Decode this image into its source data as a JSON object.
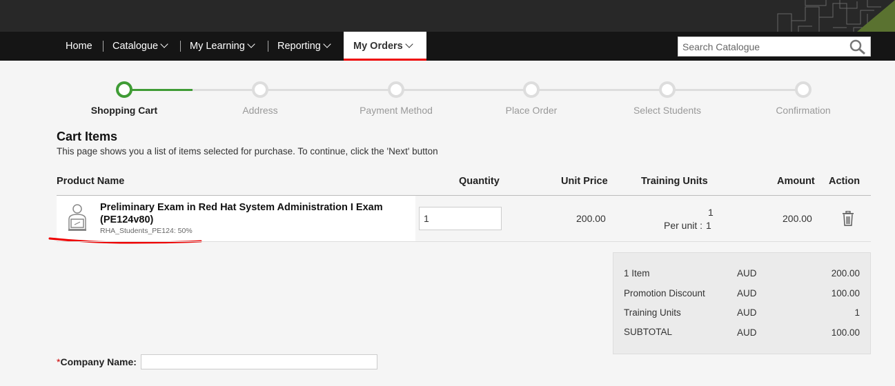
{
  "nav": {
    "items": [
      {
        "label": "Home"
      },
      {
        "label": "Catalogue"
      },
      {
        "label": "My Learning"
      },
      {
        "label": "Reporting"
      },
      {
        "label": "My Orders"
      }
    ],
    "search_placeholder": "Search Catalogue"
  },
  "steps": [
    {
      "label": "Shopping Cart",
      "status": "active"
    },
    {
      "label": "Address",
      "status": "pending"
    },
    {
      "label": "Payment Method",
      "status": "pending"
    },
    {
      "label": "Place Order",
      "status": "pending"
    },
    {
      "label": "Select Students",
      "status": "pending"
    },
    {
      "label": "Confirmation",
      "status": "pending"
    }
  ],
  "cart": {
    "title": "Cart Items",
    "description": "This page shows you a list of items selected for purchase. To continue, click the 'Next' button",
    "headers": {
      "product": "Product Name",
      "quantity": "Quantity",
      "unit_price": "Unit Price",
      "training_units": "Training Units",
      "amount": "Amount",
      "action": "Action"
    },
    "item": {
      "name": "Preliminary Exam in Red Hat System Administration I Exam (PE124v80)",
      "promo": "RHA_Students_PE124: 50%",
      "quantity": "1",
      "unit_price": "200.00",
      "training_units": "1",
      "per_unit_label": "Per unit :",
      "per_unit_value": "1",
      "amount": "200.00"
    }
  },
  "summary": {
    "rows": [
      {
        "label": "1 Item",
        "currency": "AUD",
        "value": "200.00"
      },
      {
        "label": "Promotion Discount",
        "currency": "AUD",
        "value": "100.00"
      },
      {
        "label": "Training Units",
        "currency": "AUD",
        "value": "1"
      },
      {
        "label": "SUBTOTAL",
        "currency": "AUD",
        "value": "100.00"
      }
    ]
  },
  "company": {
    "required_mark": "*",
    "label": "Company Name:",
    "value": ""
  },
  "colors": {
    "accent_green": "#3f9c35",
    "active_red": "#e00000",
    "nav_bg": "#151515"
  }
}
